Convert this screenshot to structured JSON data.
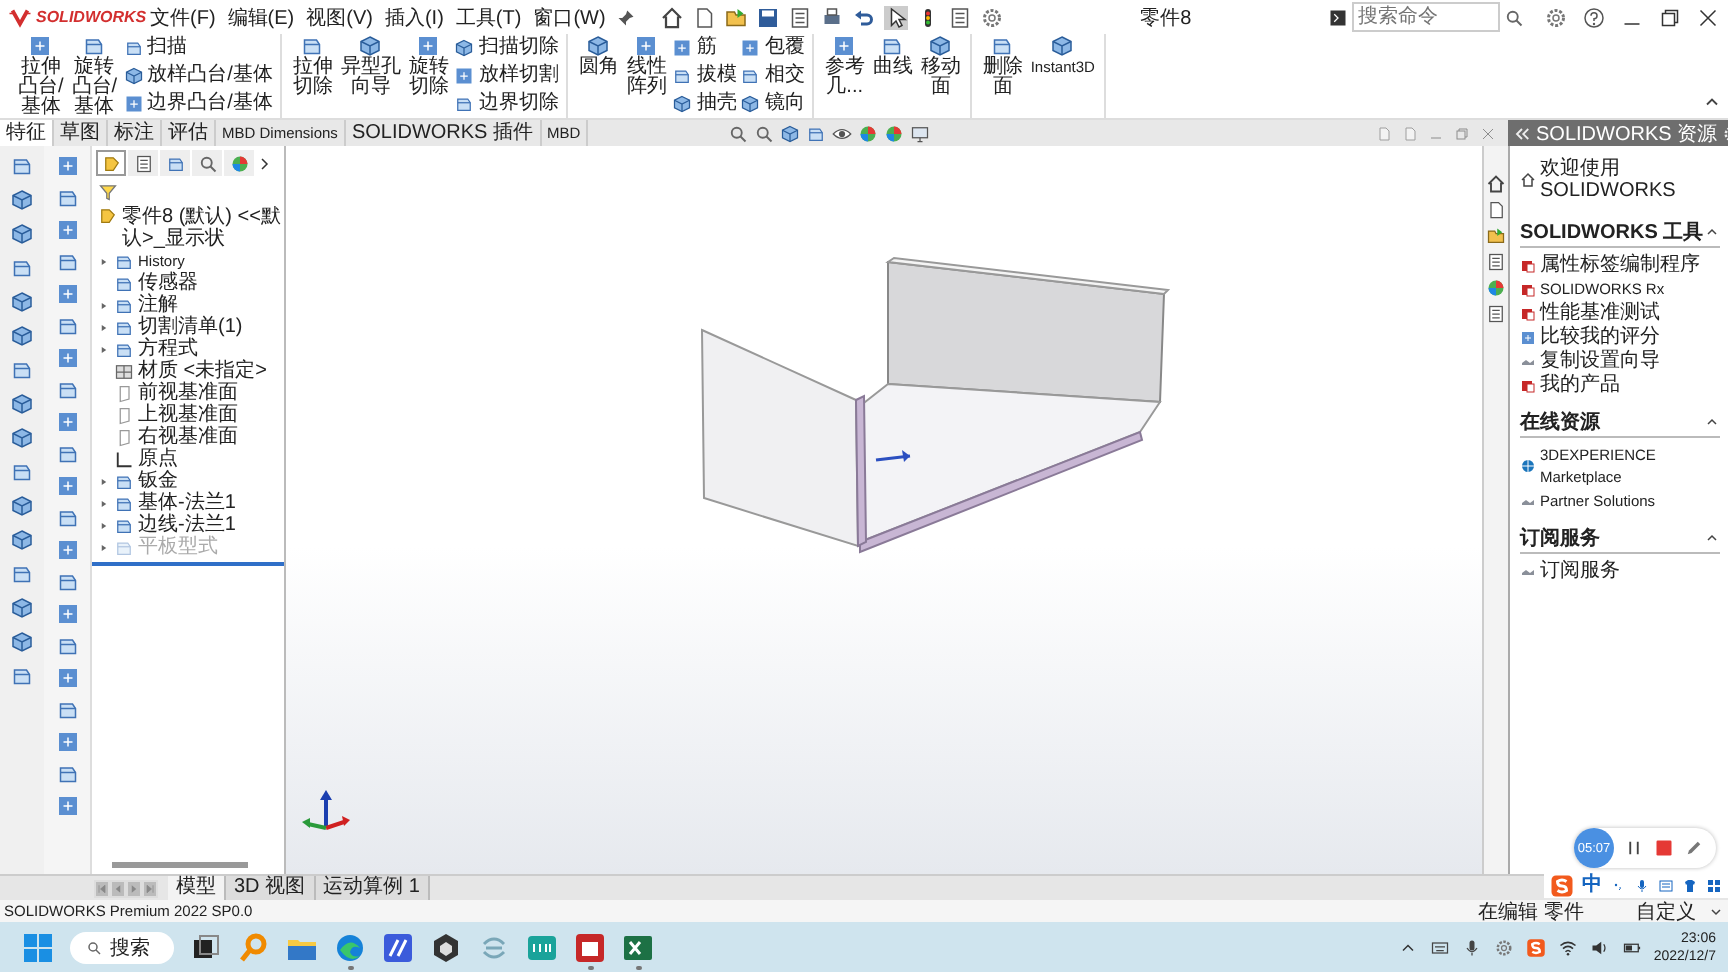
{
  "title_bar": {
    "logo": "SOLIDWORKS",
    "menus": [
      "文件(F)",
      "编辑(E)",
      "视图(V)",
      "插入(I)",
      "工具(T)",
      "窗口(W)"
    ],
    "document_title": "零件8",
    "search": {
      "placeholder": "搜索命令"
    }
  },
  "ribbon": {
    "groups": [
      {
        "large": [
          {
            "label_lines": [
              "拉伸",
              "凸台/",
              "基体"
            ]
          },
          {
            "label_lines": [
              "旋转",
              "凸台/",
              "基体"
            ]
          }
        ],
        "small": [
          [
            "扫描",
            "放样凸台/基体",
            "边界凸台/基体"
          ]
        ]
      },
      {
        "large": [
          {
            "label_lines": [
              "拉伸",
              "切除"
            ]
          },
          {
            "label_lines": [
              "异型孔",
              "向导"
            ]
          },
          {
            "label_lines": [
              "旋转",
              "切除"
            ]
          }
        ],
        "small": [
          [
            "扫描切除",
            "放样切割",
            "边界切除"
          ]
        ]
      },
      {
        "large": [
          {
            "label_lines": [
              "圆角"
            ]
          },
          {
            "label_lines": [
              "线性",
              "阵列"
            ]
          }
        ],
        "small": [
          [
            "筋",
            "拔模",
            "抽壳"
          ],
          [
            "包覆",
            "相交",
            "镜向"
          ]
        ]
      },
      {
        "large": [
          {
            "label_lines": [
              "参考",
              "几..."
            ]
          },
          {
            "label_lines": [
              "曲线"
            ]
          },
          {
            "label_lines": [
              "移动",
              "面"
            ]
          }
        ]
      },
      {
        "large": [
          {
            "label_lines": [
              "删除",
              "面"
            ]
          },
          {
            "label_lines": [
              "Instant3D"
            ]
          }
        ]
      }
    ]
  },
  "command_tabs": [
    {
      "label": "特征",
      "selected": true
    },
    {
      "label": "草图",
      "selected": false
    },
    {
      "label": "标注",
      "selected": false
    },
    {
      "label": "评估",
      "selected": false
    },
    {
      "label": "MBD Dimensions",
      "selected": false
    },
    {
      "label": "SOLIDWORKS 插件",
      "selected": false
    },
    {
      "label": "MBD",
      "selected": false
    }
  ],
  "feature_tree": {
    "panel_tabs": [
      {
        "selected": true
      },
      {
        "selected": false
      },
      {
        "selected": false
      },
      {
        "selected": false
      },
      {
        "selected": false
      }
    ],
    "root": "零件8 (默认) <<默认>_显示状",
    "items": [
      {
        "label": "History",
        "kind": "feature",
        "expander": true,
        "disabled": false
      },
      {
        "label": "传感器",
        "kind": "feature",
        "expander": false,
        "disabled": false
      },
      {
        "label": "注解",
        "kind": "feature",
        "expander": true,
        "disabled": false
      },
      {
        "label": "切割清单(1)",
        "kind": "feature",
        "expander": true,
        "disabled": false
      },
      {
        "label": "方程式",
        "kind": "feature",
        "expander": true,
        "disabled": false
      },
      {
        "label": "材质 <未指定>",
        "kind": "material",
        "expander": false,
        "disabled": false
      },
      {
        "label": "前视基准面",
        "kind": "plane",
        "expander": false,
        "disabled": false
      },
      {
        "label": "上视基准面",
        "kind": "plane",
        "expander": false,
        "disabled": false
      },
      {
        "label": "右视基准面",
        "kind": "plane",
        "expander": false,
        "disabled": false
      },
      {
        "label": "原点",
        "kind": "origin",
        "expander": false,
        "disabled": false
      },
      {
        "label": "钣金",
        "kind": "feature",
        "expander": true,
        "disabled": false
      },
      {
        "label": "基体-法兰1",
        "kind": "feature",
        "expander": true,
        "disabled": false
      },
      {
        "label": "边线-法兰1",
        "kind": "feature",
        "expander": true,
        "disabled": false
      },
      {
        "label": "平板型式",
        "kind": "feature",
        "expander": true,
        "disabled": true
      }
    ]
  },
  "task_pane": {
    "title": "SOLIDWORKS 资源",
    "welcome": "欢迎使用 SOLIDWORKS",
    "sections": [
      {
        "title": "SOLIDWORKS 工具",
        "expanded": true,
        "items": [
          "属性标签编制程序",
          "SOLIDWORKS Rx",
          "性能基准测试",
          "比较我的评分",
          "复制设置向导",
          "我的产品"
        ]
      },
      {
        "title": "在线资源",
        "expanded": true,
        "items": [
          "3DEXPERIENCE Marketplace",
          "Partner Solutions"
        ]
      },
      {
        "title": "订阅服务",
        "expanded": true,
        "items": [
          "订阅服务"
        ]
      }
    ]
  },
  "bottom_tabs": [
    {
      "label": "模型",
      "selected": true
    },
    {
      "label": "3D 视图",
      "selected": false
    },
    {
      "label": "运动算例 1",
      "selected": false
    }
  ],
  "status_bar": {
    "product": "SOLIDWORKS Premium 2022 SP0.0",
    "mode": "在编辑 零件",
    "units": "自定义"
  },
  "recorder": {
    "timer": "05:07"
  },
  "ime_bar": {
    "mode": "中"
  },
  "taskbar": {
    "search": "搜索",
    "apps": [
      {
        "running": false
      },
      {
        "running": false
      },
      {
        "running": false
      },
      {
        "running": true
      },
      {
        "running": false
      },
      {
        "running": false
      },
      {
        "running": false
      },
      {
        "running": false
      },
      {
        "running": true
      },
      {
        "running": true
      }
    ],
    "time": "23:06",
    "date": "2022/12/7"
  }
}
